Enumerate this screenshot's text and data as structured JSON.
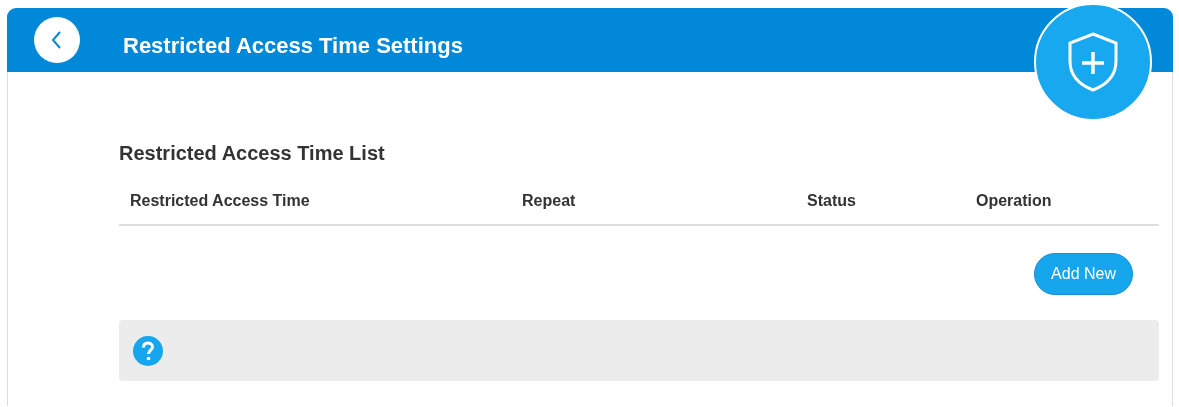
{
  "header": {
    "title": "Restricted Access Time Settings"
  },
  "list": {
    "title": "Restricted Access Time List",
    "columns": [
      "Restricted Access Time",
      "Repeat",
      "Status",
      "Operation"
    ],
    "add_button": "Add New"
  }
}
